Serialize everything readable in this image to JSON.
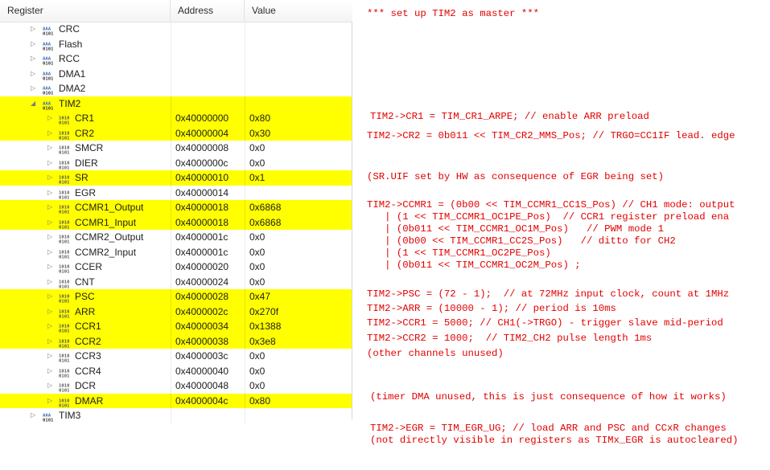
{
  "columns": {
    "register": "Register",
    "address": "Address",
    "value": "Value"
  },
  "rows": [
    {
      "name": "CRC",
      "kind": "peripheral",
      "address": "",
      "value": "",
      "expanded": false,
      "highlight": false
    },
    {
      "name": "Flash",
      "kind": "peripheral",
      "address": "",
      "value": "",
      "expanded": false,
      "highlight": false
    },
    {
      "name": "RCC",
      "kind": "peripheral",
      "address": "",
      "value": "",
      "expanded": false,
      "highlight": false
    },
    {
      "name": "DMA1",
      "kind": "peripheral",
      "address": "",
      "value": "",
      "expanded": false,
      "highlight": false
    },
    {
      "name": "DMA2",
      "kind": "peripheral",
      "address": "",
      "value": "",
      "expanded": false,
      "highlight": false
    },
    {
      "name": "TIM2",
      "kind": "peripheral",
      "address": "",
      "value": "",
      "expanded": true,
      "highlight": true
    },
    {
      "name": "CR1",
      "kind": "register",
      "address": "0x40000000",
      "value": "0x80",
      "highlight": true
    },
    {
      "name": "CR2",
      "kind": "register",
      "address": "0x40000004",
      "value": "0x30",
      "highlight": true
    },
    {
      "name": "SMCR",
      "kind": "register",
      "address": "0x40000008",
      "value": "0x0",
      "highlight": false
    },
    {
      "name": "DIER",
      "kind": "register",
      "address": "0x4000000c",
      "value": "0x0",
      "highlight": false
    },
    {
      "name": "SR",
      "kind": "register",
      "address": "0x40000010",
      "value": "0x1",
      "highlight": true
    },
    {
      "name": "EGR",
      "kind": "register",
      "address": "0x40000014",
      "value": "",
      "highlight": false
    },
    {
      "name": "CCMR1_Output",
      "kind": "register",
      "address": "0x40000018",
      "value": "0x6868",
      "highlight": true
    },
    {
      "name": "CCMR1_Input",
      "kind": "register",
      "address": "0x40000018",
      "value": "0x6868",
      "highlight": true
    },
    {
      "name": "CCMR2_Output",
      "kind": "register",
      "address": "0x4000001c",
      "value": "0x0",
      "highlight": false
    },
    {
      "name": "CCMR2_Input",
      "kind": "register",
      "address": "0x4000001c",
      "value": "0x0",
      "highlight": false
    },
    {
      "name": "CCER",
      "kind": "register",
      "address": "0x40000020",
      "value": "0x0",
      "highlight": false
    },
    {
      "name": "CNT",
      "kind": "register",
      "address": "0x40000024",
      "value": "0x0",
      "highlight": false
    },
    {
      "name": "PSC",
      "kind": "register",
      "address": "0x40000028",
      "value": "0x47",
      "highlight": true
    },
    {
      "name": "ARR",
      "kind": "register",
      "address": "0x4000002c",
      "value": "0x270f",
      "highlight": true
    },
    {
      "name": "CCR1",
      "kind": "register",
      "address": "0x40000034",
      "value": "0x1388",
      "highlight": true
    },
    {
      "name": "CCR2",
      "kind": "register",
      "address": "0x40000038",
      "value": "0x3e8",
      "highlight": true
    },
    {
      "name": "CCR3",
      "kind": "register",
      "address": "0x4000003c",
      "value": "0x0",
      "highlight": false
    },
    {
      "name": "CCR4",
      "kind": "register",
      "address": "0x40000040",
      "value": "0x0",
      "highlight": false
    },
    {
      "name": "DCR",
      "kind": "register",
      "address": "0x40000048",
      "value": "0x0",
      "highlight": false
    },
    {
      "name": "DMAR",
      "kind": "register",
      "address": "0x4000004c",
      "value": "0x80",
      "highlight": true
    },
    {
      "name": "TIM3",
      "kind": "peripheral",
      "address": "",
      "value": "",
      "expanded": false,
      "highlight": false
    }
  ],
  "notes": [
    "*** set up TIM2 as master ***",
    "TIM2->CR1 = TIM_CR1_ARPE; // enable ARR preload",
    "TIM2->CR2 = 0b011 << TIM_CR2_MMS_Pos; // TRGO=CC1IF lead. edge",
    "(SR.UIF set by HW as consequence of EGR being set)",
    "TIM2->CCMR1 = (0b00 << TIM_CCMR1_CC1S_Pos) // CH1 mode: output\n   | (1 << TIM_CCMR1_OC1PE_Pos)  // CCR1 register preload ena\n   | (0b011 << TIM_CCMR1_OC1M_Pos)   // PWM mode 1\n   | (0b00 << TIM_CCMR1_CC2S_Pos)   // ditto for CH2\n   | (1 << TIM_CCMR1_OC2PE_Pos)\n   | (0b011 << TIM_CCMR1_OC2M_Pos) ;",
    "TIM2->PSC = (72 - 1);  // at 72MHz input clock, count at 1MHz",
    "TIM2->ARR = (10000 - 1); // period is 10ms",
    "TIM2->CCR1 = 5000; // CH1(->TRGO) - trigger slave mid-period",
    "TIM2->CCR2 = 1000;  // TIM2_CH2 pulse length 1ms",
    "(other channels unused)",
    "(timer DMA unused, this is just consequence of how it works)",
    "TIM2->EGR = TIM_EGR_UG; // load ARR and PSC and CCxR changes\n(not directly visible in registers as TIMx_EGR is autocleared)"
  ],
  "colors": {
    "highlight": "#ffff00",
    "notes_text": "#e30000",
    "icon_blue": "#3a6fb4"
  }
}
